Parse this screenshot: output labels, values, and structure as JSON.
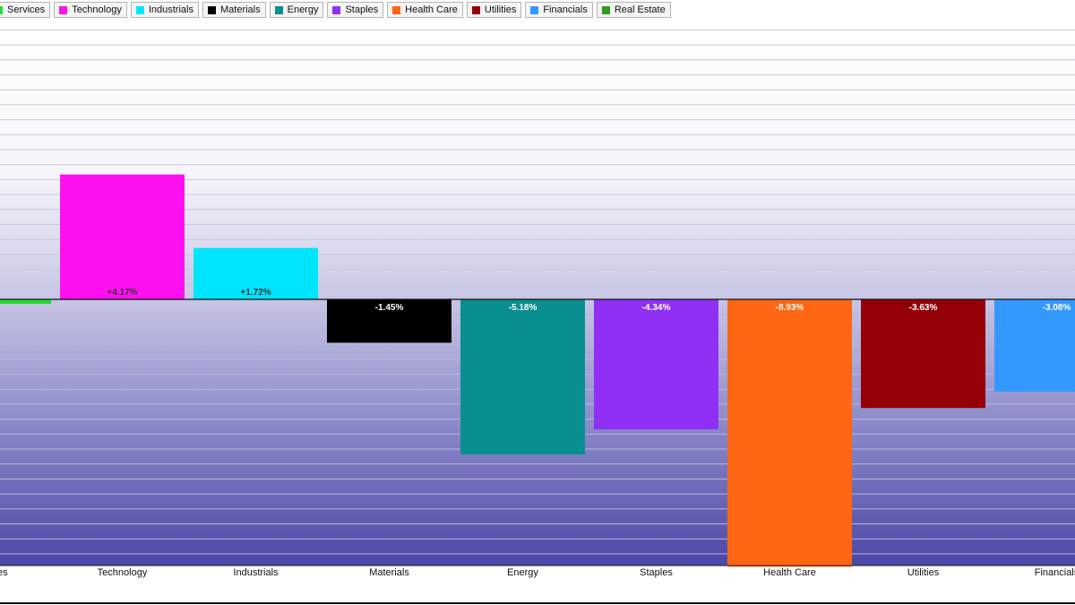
{
  "legend": [
    {
      "label": "Services",
      "color": "#22dd33"
    },
    {
      "label": "Technology",
      "color": "#ff10f0"
    },
    {
      "label": "Industrials",
      "color": "#00e5ff"
    },
    {
      "label": "Materials",
      "color": "#000000"
    },
    {
      "label": "Energy",
      "color": "#0a8f91"
    },
    {
      "label": "Staples",
      "color": "#9030f5"
    },
    {
      "label": "Health Care",
      "color": "#ff6613"
    },
    {
      "label": "Utilities",
      "color": "#950007"
    },
    {
      "label": "Financials",
      "color": "#3399ff"
    },
    {
      "label": "Real Estate",
      "color": "#2e9b1c"
    }
  ],
  "chart_data": {
    "type": "bar",
    "categories": [
      "Services",
      "Technology",
      "Industrials",
      "Materials",
      "Energy",
      "Staples",
      "Health Care",
      "Utilities",
      "Financials"
    ],
    "values": [
      -0.15,
      4.17,
      1.72,
      -1.45,
      -5.18,
      -4.34,
      -8.93,
      -3.63,
      -3.08
    ],
    "data_labels": [
      "%",
      "+4.17%",
      "+1.72%",
      "-1.45%",
      "-5.18%",
      "-4.34%",
      "-8.93%",
      "-3.63%",
      "-3.08%"
    ],
    "colors": [
      "#22dd33",
      "#ff10f0",
      "#00e5ff",
      "#000000",
      "#0a8f91",
      "#9030f5",
      "#ff6613",
      "#950007",
      "#3399ff"
    ],
    "ylim": [
      -9,
      8.5
    ],
    "grid": true,
    "legend_position": "top"
  }
}
